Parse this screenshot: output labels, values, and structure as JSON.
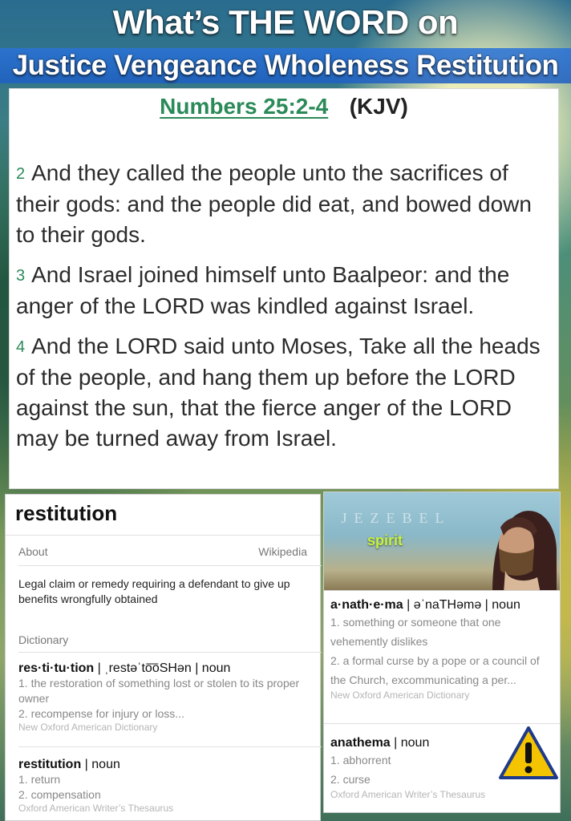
{
  "header": {
    "title_line1": "What’s THE WORD on",
    "title_line2": "Justice Vengeance Wholeness Restitution"
  },
  "scripture": {
    "reference": "Numbers 25:2-4",
    "version": "(KJV)",
    "verses": [
      {
        "num": "2",
        "text": "And they called the people unto the sacrifices of their gods: and the people did eat, and bowed down to their gods."
      },
      {
        "num": "3",
        "text": "And Israel joined himself unto Baalpeor: and the anger of the LORD was kindled against Israel."
      },
      {
        "num": "4",
        "text": "And the LORD said unto Moses, Take all the heads of the people, and hang them up before the LORD against the sun, that the fierce anger of the LORD may be turned away from Israel."
      }
    ]
  },
  "restitution_card": {
    "word": "restitution",
    "about_label": "About",
    "wiki_label": "Wikipedia",
    "about_definition": "Legal claim or remedy requiring a defendant to give up benefits wrongfully obtained",
    "dictionary_label": "Dictionary",
    "entry1": {
      "headword": "res·ti·tu·tion",
      "pronunciation": "| ˌrestəˈto͞oSHən | noun",
      "sense1": "1. the restoration of something lost or stolen to its proper owner",
      "sense2": "2. recompense for injury or loss...",
      "source": "New Oxford American Dictionary"
    },
    "entry2": {
      "headword": "restitution",
      "pos": "| noun",
      "sense1": "1. return",
      "sense2": "2. compensation",
      "source": "Oxford American Writer’s Thesaurus"
    }
  },
  "anathema_card": {
    "image_title": "JEZEBEL",
    "image_caption": "spirit",
    "entry1": {
      "headword": "a·nath·e·ma",
      "pronunciation": "| əˈnaTHəmə | noun",
      "sense1": "1. something or someone that one vehemently dislikes",
      "sense2": "2. a formal curse by a pope or a council of the Church, excommunicating a per...",
      "source": "New Oxford American Dictionary"
    },
    "entry2": {
      "headword": "anathema",
      "pos": "| noun",
      "sense1": "1. abhorrent",
      "sense2": "2. curse",
      "source": "Oxford American Writer’s Thesaurus"
    },
    "warning_icon": "warning-triangle-icon"
  },
  "colors": {
    "accent_green": "#2a8a58",
    "title_bar_blue": "#1e5fc4",
    "warning_yellow": "#f5c400"
  }
}
